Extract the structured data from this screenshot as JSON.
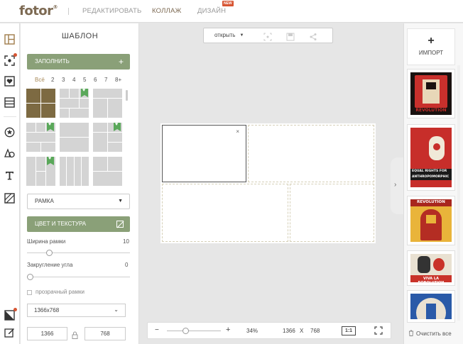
{
  "header": {
    "logo": "fotor",
    "logo_mark": "®",
    "nav": [
      {
        "label": "РЕДАКТИРОВАТЬ"
      },
      {
        "label": "КОЛЛАЖ"
      },
      {
        "label": "ДИЗАЙН"
      }
    ],
    "new_badge": "NEW",
    "accent": "#7d6a53"
  },
  "iconbar": {
    "items": [
      "template-icon",
      "stickers-icon",
      "favorite-icon",
      "layout-icon",
      "star-icon",
      "shapes-icon",
      "text-icon",
      "texture-icon",
      "background-icon",
      "edit-icon"
    ]
  },
  "panel": {
    "title": "ШАБЛОН",
    "fill_button": "ЗАПОЛНИТЬ",
    "tabs": [
      "Всё",
      "2",
      "3",
      "4",
      "5",
      "6",
      "7",
      "8+"
    ],
    "frame_select": "РАМКА",
    "color_texture_button": "ЦВЕТ И ТЕКСТУРА",
    "border_width_label": "Ширина рамки",
    "border_width_value": "10",
    "border_width_level": 0.2,
    "corner_label": "Закругление угла",
    "corner_value": "0",
    "corner_level": 0,
    "transparent_label": "прозрачный рамки",
    "size_select": "1366x768",
    "width": "1366",
    "height": "768"
  },
  "toolbar": {
    "open_label": "открыть"
  },
  "canvas": {
    "close_glyph": "×"
  },
  "right": {
    "import_plus": "+",
    "import_label": "ИМПОРТ",
    "posters": [
      {
        "text": "REVOLUTION"
      },
      {
        "text": "EQUAL RIGHTS FOR ANTHROPOMORPHIC AUTOMATONS"
      },
      {
        "text": "REVOLUTION"
      },
      {
        "text": "VIVA LA ROBOLUTION"
      },
      {
        "text": ""
      }
    ],
    "clear_label": "Очистить все"
  },
  "zoombar": {
    "minus": "−",
    "plus": "+",
    "zoom": "34%",
    "width": "1366",
    "x": "X",
    "height": "768",
    "one_to_one": "1:1",
    "zoom_level": 0.34
  }
}
